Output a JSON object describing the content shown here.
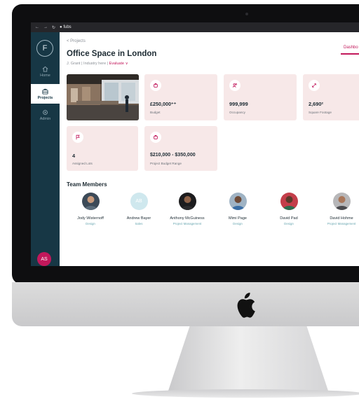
{
  "browser": {
    "url": "fubs"
  },
  "sidebar": {
    "logo": "F",
    "items": [
      {
        "label": "Home",
        "icon": "home-icon"
      },
      {
        "label": "Projects",
        "icon": "briefcase-icon",
        "active": true
      },
      {
        "label": "Admin",
        "icon": "gear-icon"
      }
    ],
    "user_initials": "AS"
  },
  "header": {
    "breadcrumb": "< Projects",
    "title": "Office Space in London",
    "more": "···",
    "meta_left": "J. Grant | Industry here |",
    "meta_status": "Evaluate ∨",
    "tab": "Dashbo"
  },
  "stats": [
    {
      "value": "£250,000⁺⁺",
      "label": "Budget",
      "icon": "tag-icon"
    },
    {
      "value": "999,999",
      "label": "Occupancy",
      "icon": "people-icon"
    },
    {
      "value": "2,690²",
      "label": "Square Footage",
      "icon": "expand-icon"
    },
    {
      "value": "4",
      "label": "Assigned Lots",
      "icon": "flag-icon"
    },
    {
      "value": "$210,000 - $350,000",
      "label": "Project Budget Range",
      "icon": "tag-icon"
    }
  ],
  "team": {
    "heading": "Team Members",
    "members": [
      {
        "name": "Jody Wisternoff",
        "role": "Design"
      },
      {
        "name": "Andrew Bayer",
        "role": "Sales",
        "initials": "AB"
      },
      {
        "name": "Anthony McGuiness",
        "role": "Project Management"
      },
      {
        "name": "Mimi Page",
        "role": "Design"
      },
      {
        "name": "David Pad",
        "role": "Design"
      },
      {
        "name": "David Hohme",
        "role": "Project Management"
      }
    ]
  },
  "colors": {
    "accent": "#c2185b",
    "sidebar": "#173745",
    "card": "#f7e8e8"
  }
}
